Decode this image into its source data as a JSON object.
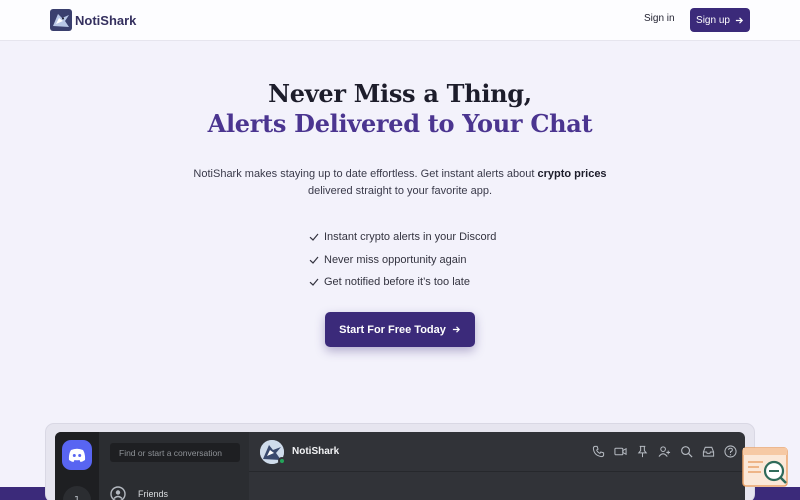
{
  "header": {
    "brand": "NotiShark",
    "signin_label": "Sign in",
    "signup_label": "Sign up",
    "signup_icon": "arrow-right-icon"
  },
  "hero": {
    "title_line1": "Never Miss a Thing,",
    "title_line2": "Alerts Delivered to Your Chat",
    "subtitle_part1": "NotiShark makes staying up to date effortless. Get instant alerts about ",
    "subtitle_bold": "crypto prices",
    "subtitle_part2": "delivered straight to your favorite app.",
    "features": [
      "Instant crypto alerts in your Discord",
      "Never miss opportunity again",
      "Get notified before it’s too late"
    ],
    "cta_label": "Start For Free Today"
  },
  "mockup": {
    "search_placeholder": "Find or start a conversation",
    "friends_label": "Friends",
    "rail_badge": "1",
    "chat_name": "NotiShark",
    "toolbar_icons": [
      "phone-icon",
      "video-icon",
      "pin-icon",
      "add-member-icon",
      "search-icon",
      "inbox-icon",
      "help-icon"
    ]
  },
  "colors": {
    "brand": "#3b2a7a",
    "accent_title": "#4b3590",
    "page_bg": "#f3f2fb",
    "discord_blurple": "#5865f2",
    "online": "#23a55a"
  }
}
